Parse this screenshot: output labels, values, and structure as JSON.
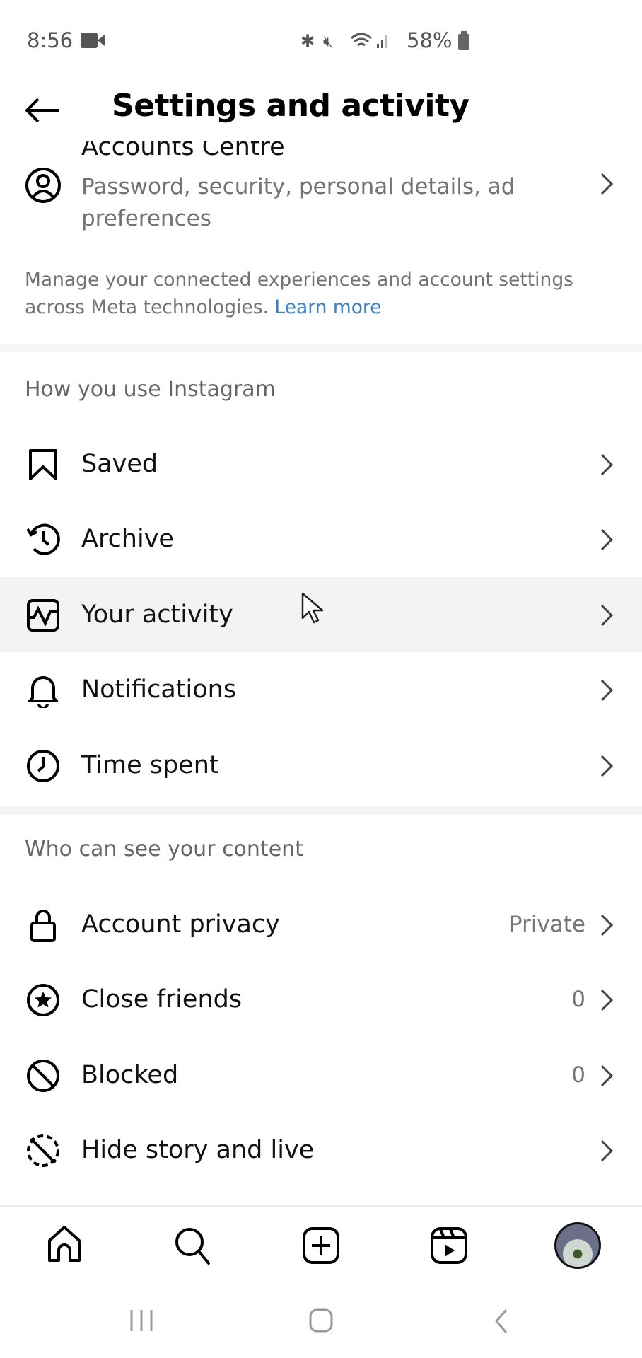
{
  "status_bar": {
    "time": "8:56",
    "battery": "58%"
  },
  "header": {
    "title": "Settings and activity"
  },
  "accounts_centre": {
    "title": "Accounts Centre",
    "subtitle": "Password, security, personal details, ad preferences",
    "note": "Manage your connected experiences and account settings across Meta technologies.",
    "learn_more": "Learn more"
  },
  "sections": [
    {
      "title": "How you use Instagram",
      "items": [
        {
          "label": "Saved",
          "icon": "bookmark-icon"
        },
        {
          "label": "Archive",
          "icon": "archive-icon"
        },
        {
          "label": "Your activity",
          "icon": "activity-icon"
        },
        {
          "label": "Notifications",
          "icon": "bell-icon"
        },
        {
          "label": "Time spent",
          "icon": "clock-icon"
        }
      ]
    },
    {
      "title": "Who can see your content",
      "items": [
        {
          "label": "Account privacy",
          "value": "Private",
          "icon": "lock-icon"
        },
        {
          "label": "Close friends",
          "value": "0",
          "icon": "star-icon"
        },
        {
          "label": "Blocked",
          "value": "0",
          "icon": "block-icon"
        },
        {
          "label": "Hide story and live",
          "icon": "hide-story-icon"
        }
      ]
    }
  ],
  "colors": {
    "link": "#3b82c4",
    "highlight": "#f2f4f4"
  }
}
